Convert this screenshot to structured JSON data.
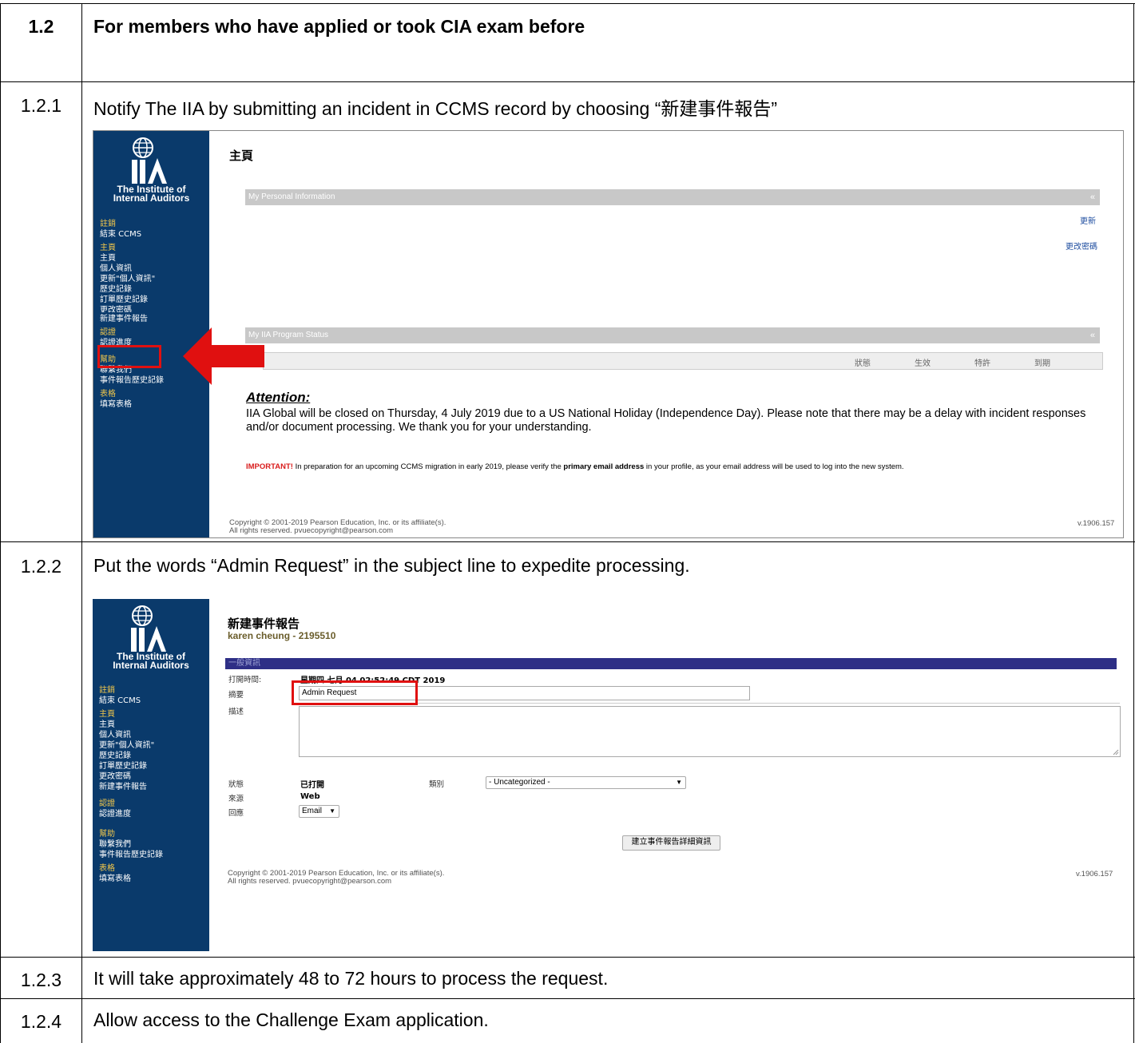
{
  "section": {
    "number": "1.2",
    "title": "For members who have applied or took CIA exam before"
  },
  "steps": [
    {
      "number": "1.2.1",
      "text": "Notify The IIA by submitting an incident in CCMS record by choosing “新建事件報告”"
    },
    {
      "number": "1.2.2",
      "text": "Put the words “Admin Request” in the subject line to expedite processing."
    },
    {
      "number": "1.2.3",
      "text": "It will take approximately 48 to 72 hours to process the request."
    },
    {
      "number": "1.2.4",
      "text": "Allow access to the Challenge Exam application."
    }
  ],
  "logo": {
    "line1": "The Institute of",
    "line2": "Internal Auditors"
  },
  "sidebar": {
    "items": [
      {
        "label": "註銷",
        "kind": "section"
      },
      {
        "label": "結束 CCMS",
        "kind": "link"
      },
      {
        "label": "主頁",
        "kind": "section"
      },
      {
        "label": "主頁",
        "kind": "link"
      },
      {
        "label": "個人資訊",
        "kind": "link"
      },
      {
        "label": "更新\"個人資訊\"",
        "kind": "link"
      },
      {
        "label": "歷史記錄",
        "kind": "link"
      },
      {
        "label": "訂單歷史記錄",
        "kind": "link"
      },
      {
        "label": "更改密碼",
        "kind": "link"
      },
      {
        "label": "新建事件報告",
        "kind": "link"
      },
      {
        "label": "認證",
        "kind": "section"
      },
      {
        "label": "認證進度",
        "kind": "link"
      },
      {
        "label": "幫助",
        "kind": "section"
      },
      {
        "label": "聯繫我們",
        "kind": "link"
      },
      {
        "label": "事件報告歷史記錄",
        "kind": "link"
      },
      {
        "label": "表格",
        "kind": "section"
      },
      {
        "label": "填寫表格",
        "kind": "link"
      }
    ]
  },
  "home": {
    "title": "主頁",
    "personal_info_bar": "My Personal Information",
    "update_link": "更新",
    "change_password_link": "更改密碼",
    "program_status_bar": "My IIA Program Status",
    "status_columns": [
      "狀態",
      "生效",
      "特許",
      "到期"
    ],
    "attention_title": "Attention:",
    "attention_body": "IIA Global will be closed on Thursday, 4 July 2019 due to a US National Holiday (Independence Day). Please note that there may be a delay with incident responses and/or document processing. We thank you for your understanding.",
    "important_label": "IMPORTANT!",
    "important_text_1": " In preparation for an upcoming CCMS migration in early 2019, please verify the ",
    "important_bold": "primary email address",
    "important_text_2": " in your profile, as your email address will be used to log into the new system.",
    "chevron": "«"
  },
  "footer": {
    "copyright_1": "Copyright © 2001-2019 Pearson Education, Inc. or its affiliate(s).",
    "copyright_2": "All rights reserved. pvuecopyright@pearson.com",
    "version": "v.1906.157"
  },
  "incident": {
    "title": "新建事件報告",
    "user": "karen cheung - 2195510",
    "section_bar": "一般資訊",
    "opened_label": "打開時間:",
    "opened_value": "星期四 七月 04 02:52:49 CDT 2019",
    "summary_label": "摘要",
    "summary_value": "Admin Request",
    "description_label": "描述",
    "status_label": "狀態",
    "status_value": "已打開",
    "category_label": "類別",
    "category_value": "- Uncategorized -",
    "source_label": "來源",
    "source_value": "Web",
    "response_label": "回應",
    "response_value": "Email",
    "submit_label": "建立事件報告詳細資訊"
  }
}
